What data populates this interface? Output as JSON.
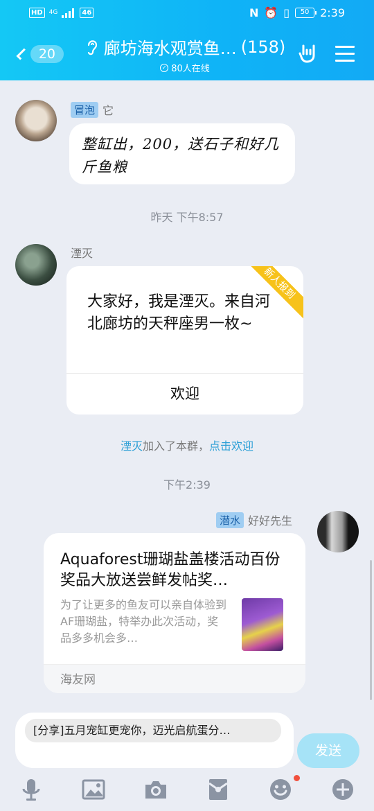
{
  "status_bar": {
    "left_badges": [
      "HD",
      "4G",
      "46"
    ],
    "battery": "50",
    "time": "2:39"
  },
  "header": {
    "back_count": "20",
    "title": "廊坊海水观赏鱼…",
    "member_count": "(158)",
    "online": "80人在线"
  },
  "messages": {
    "m1": {
      "tag": "冒泡",
      "name": "它",
      "text": "整缸出，200，送石子和好几斤鱼粮"
    },
    "time1": "昨天 下午8:57",
    "m2": {
      "name": "湮灭",
      "ribbon": "新人报到",
      "text": "大家好，我是湮灭。来自河北廊坊的天秤座男一枚~",
      "button": "欢迎"
    },
    "system": {
      "user": "湮灭",
      "text": "加入了本群，",
      "link": "点击欢迎"
    },
    "time2": "下午2:39",
    "m3": {
      "tag": "潜水",
      "name": "好好先生",
      "title": "Aquaforest珊瑚盐盖楼活动百份奖品大放送尝鲜发帖奖…",
      "desc": "为了让更多的鱼友可以亲自体验到AF珊瑚盐，特举办此次活动，奖品多多机会多…",
      "source": "海友网"
    }
  },
  "input": {
    "chip": "[分享]五月宠缸更宠你，迈光启航蛋分…",
    "send": "发送"
  },
  "toolbar": [
    "microphone-icon",
    "image-icon",
    "camera-icon",
    "red-packet-icon",
    "emoji-icon",
    "plus-icon"
  ],
  "colors": {
    "header_start": "#14c8f5",
    "header_end": "#12aaf5",
    "link": "#2c9fd6",
    "ribbon": "#f7c21a",
    "send_button": "#a6e3f7"
  }
}
